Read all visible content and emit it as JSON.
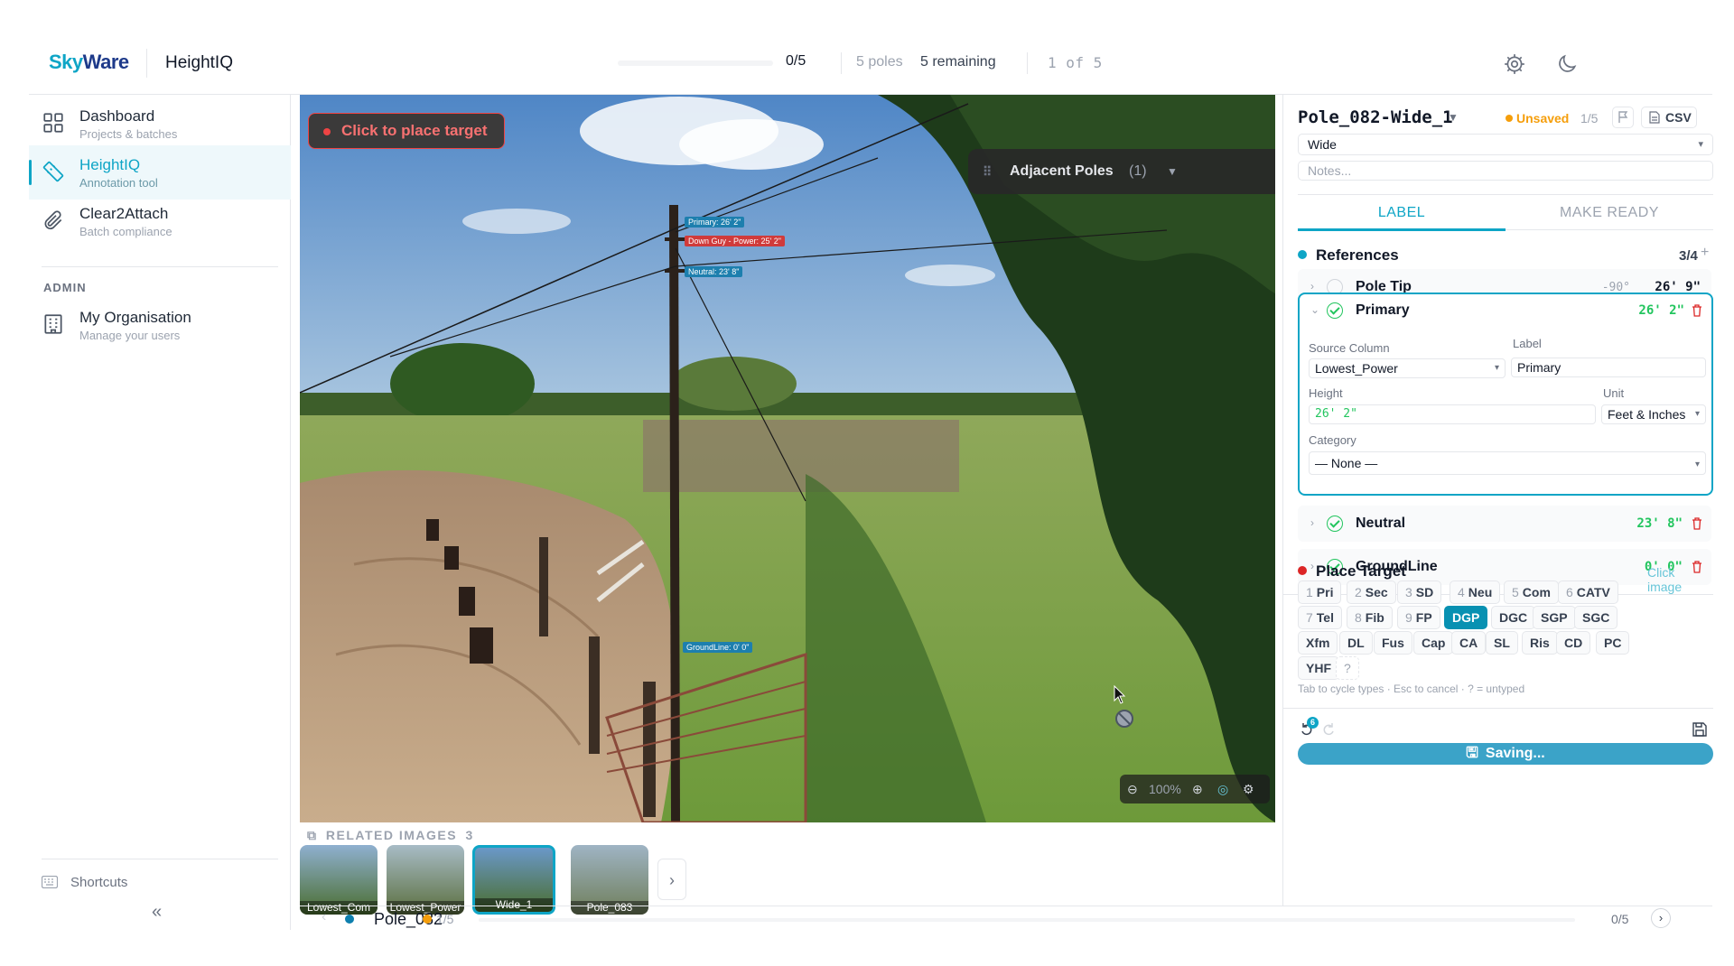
{
  "header": {
    "logo_sky": "Sky",
    "logo_ware": "Ware",
    "app_title": "HeightIQ",
    "progress_fraction": 0,
    "progress_count": "0/5",
    "poles": "5 poles",
    "remaining": "5 remaining",
    "position": "1 of 5",
    "icons": [
      "gear-icon",
      "moon-icon"
    ]
  },
  "sidebar": {
    "items": [
      {
        "label": "Dashboard",
        "sub": "Projects & batches",
        "icon": "dashboard-icon"
      },
      {
        "label": "HeightIQ",
        "sub": "Annotation tool",
        "icon": "ruler-icon"
      },
      {
        "label": "Clear2Attach",
        "sub": "Batch compliance",
        "icon": "paperclip-icon"
      }
    ],
    "admin_label": "ADMIN",
    "admin_items": [
      {
        "label": "My Organisation",
        "sub": "Manage your users",
        "icon": "building-icon"
      }
    ],
    "shortcuts": "Shortcuts",
    "collapse": "«"
  },
  "canvas": {
    "place_target_label": "Click to place target",
    "adjacent_label": "Adjacent Poles",
    "adjacent_count": "(1)",
    "tags": {
      "primary": "Primary: 26' 2\"",
      "downguy": "Down Guy - Power: 25' 2\"",
      "neutral": "Neutral: 23' 8\"",
      "ground": "GroundLine: 0' 0\""
    },
    "zoom": "100%"
  },
  "related": {
    "title": "RELATED IMAGES",
    "count": "3",
    "thumbs": [
      {
        "label": "Lowest_Com"
      },
      {
        "label": "Lowest_Power"
      },
      {
        "label": "Wide_1"
      },
      {
        "label": "Pole_083"
      }
    ],
    "next": "›"
  },
  "footer": {
    "pole": "Pole_082",
    "fraction": "1/5",
    "count": "0/5",
    "prev": "‹",
    "next": "›"
  },
  "panel": {
    "title": "Pole_082-Wide_1",
    "unsaved": "Unsaved",
    "fraction": "1/5",
    "csv": "CSV",
    "view": "Wide",
    "notes_placeholder": "Notes...",
    "tabs": [
      "LABEL",
      "MAKE READY"
    ],
    "refs_title": "References",
    "refs_count": "3/4",
    "refs_plus": "+",
    "refs": [
      {
        "name": "Pole Tip",
        "angle": "-90°",
        "value": "26' 9\""
      },
      {
        "name": "Primary",
        "value": "26' 2\""
      },
      {
        "name": "Neutral",
        "value": "23' 8\""
      },
      {
        "name": "GroundLine",
        "value": "0' 0\""
      }
    ],
    "detail": {
      "source_column_label": "Source Column",
      "source_column": "Lowest_Power",
      "label_label": "Label",
      "label": "Primary",
      "height_label": "Height",
      "height": "26' 2\"",
      "unit_label": "Unit",
      "unit": "Feet & Inches",
      "category_label": "Category",
      "category": "— None —"
    },
    "place_target_title": "Place Target",
    "click_image": "Click image",
    "chips": [
      {
        "k": "1",
        "t": "Pri"
      },
      {
        "k": "2",
        "t": "Sec"
      },
      {
        "k": "3",
        "t": "SD"
      },
      {
        "k": "4",
        "t": "Neu"
      },
      {
        "k": "5",
        "t": "Com"
      },
      {
        "k": "6",
        "t": "CATV"
      },
      {
        "k": "7",
        "t": "Tel"
      },
      {
        "k": "8",
        "t": "Fib"
      },
      {
        "k": "9",
        "t": "FP"
      },
      {
        "k": "",
        "t": "DGP"
      },
      {
        "k": "",
        "t": "DGC"
      },
      {
        "k": "",
        "t": "SGP"
      },
      {
        "k": "",
        "t": "SGC"
      },
      {
        "k": "",
        "t": "Xfm"
      },
      {
        "k": "",
        "t": "DL"
      },
      {
        "k": "",
        "t": "Fus"
      },
      {
        "k": "",
        "t": "Cap"
      },
      {
        "k": "",
        "t": "CA"
      },
      {
        "k": "",
        "t": "SL"
      },
      {
        "k": "",
        "t": "Ris"
      },
      {
        "k": "",
        "t": "CD"
      },
      {
        "k": "",
        "t": "PC"
      },
      {
        "k": "",
        "t": "YHF"
      },
      {
        "k": "",
        "t": "?"
      }
    ],
    "hint": "Tab to cycle types · Esc to cancel · ? = untyped",
    "undo_count": "6",
    "saving": "Saving..."
  },
  "colors": {
    "accent": "#0ea5c6",
    "unsaved": "#f59e0b",
    "danger": "#dc2626",
    "ok": "#22c55e"
  }
}
